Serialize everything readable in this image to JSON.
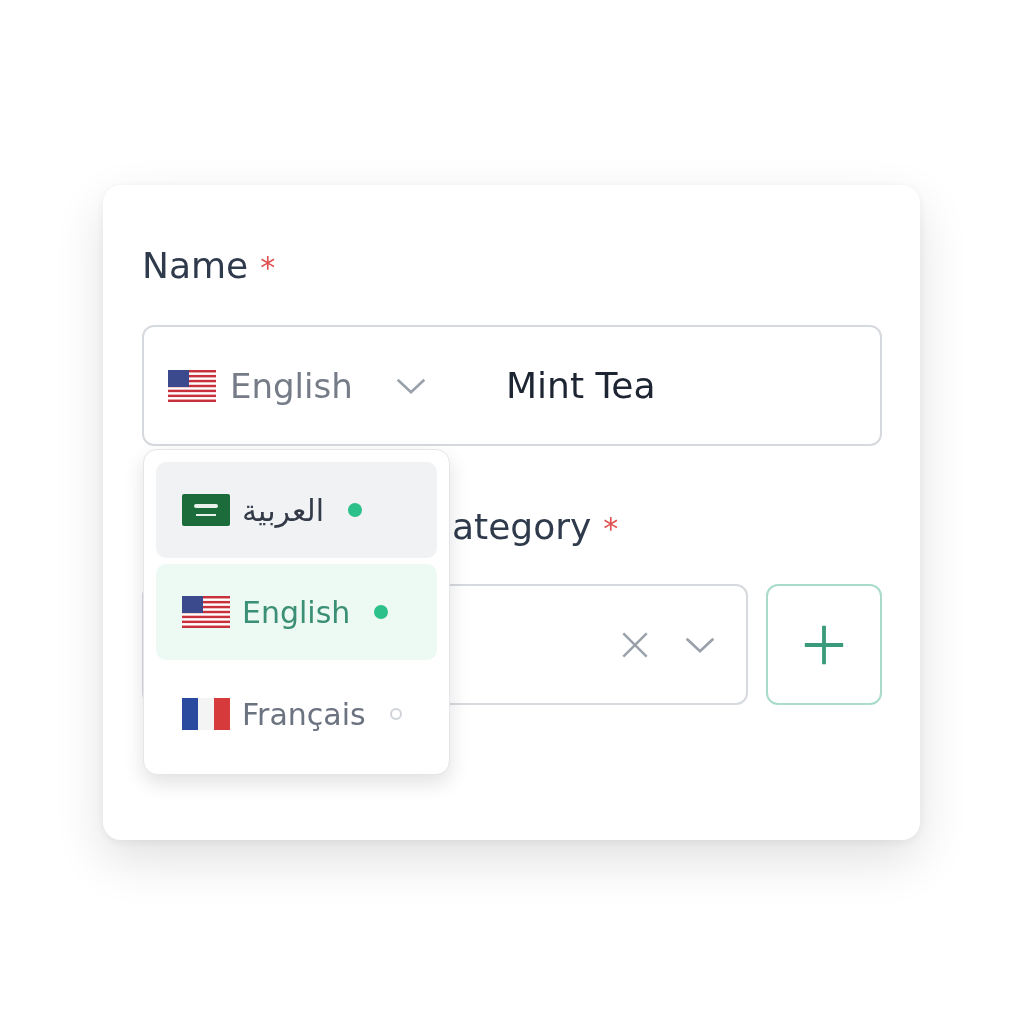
{
  "name_field": {
    "label": "Name",
    "required_mark": "*",
    "language": {
      "kind": "us",
      "label": "English"
    },
    "value": "Mint Tea"
  },
  "language_menu": {
    "items": [
      {
        "kind": "sa",
        "label": "العربية",
        "hovered": true,
        "selected": false,
        "filled": true
      },
      {
        "kind": "us",
        "label": "English",
        "hovered": false,
        "selected": true,
        "filled": true
      },
      {
        "kind": "fr",
        "label": "Français",
        "hovered": false,
        "selected": false,
        "filled": false
      }
    ]
  },
  "category_field": {
    "label": "ategory",
    "required_mark": "*"
  }
}
